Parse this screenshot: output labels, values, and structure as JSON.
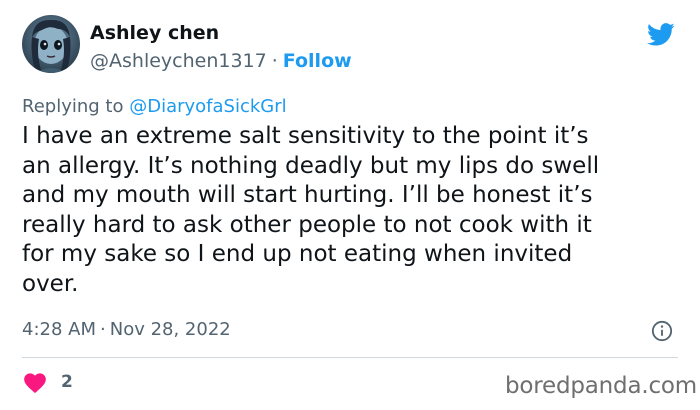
{
  "author": {
    "name": "Ashley chen",
    "handle": "@Ashleychen1317",
    "separator": "·",
    "follow_label": "Follow"
  },
  "reply": {
    "prefix": "Replying to",
    "mention": "@DiaryofaSickGrl"
  },
  "tweet": {
    "lines": [
      "I have an extreme salt sensitivity to the point it’s",
      "an allergy. It’s nothing deadly but my lips do swell",
      "and my mouth will start hurting. I’ll be honest it’s",
      "really hard to ask other people to not cook with it",
      "for my sake so I end up not eating when invited",
      "over."
    ]
  },
  "meta": {
    "time": "4:28 AM",
    "separator": "·",
    "date": "Nov 28, 2022"
  },
  "engagement": {
    "like_count": "2"
  },
  "watermark": "boredpanda.com",
  "icons": {
    "brand": "twitter-bird-icon",
    "info": "info-icon",
    "like": "heart-icon"
  },
  "colors": {
    "accent": "#1d9bf0",
    "like": "#f91880",
    "muted": "#536471",
    "text": "#0f1419"
  }
}
